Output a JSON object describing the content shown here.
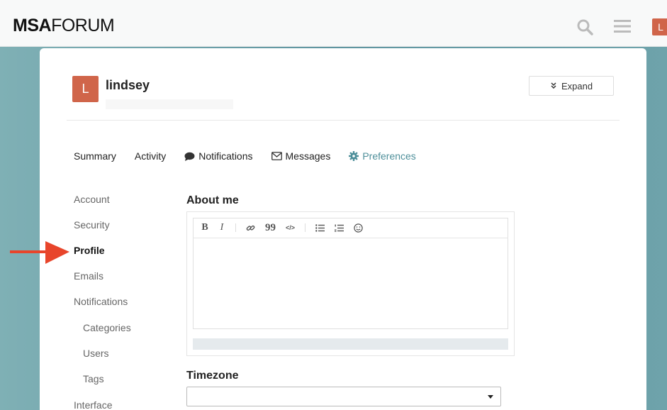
{
  "header": {
    "logo_bold": "MSA",
    "logo_light": "FORUM",
    "search_icon": "search-icon",
    "menu_icon": "hamburger-menu-icon",
    "avatar_letter": "L"
  },
  "user": {
    "avatar_letter": "L",
    "name": "lindsey",
    "expand_label": "Expand"
  },
  "tabs": [
    {
      "label": "Summary",
      "icon": null
    },
    {
      "label": "Activity",
      "icon": null
    },
    {
      "label": "Notifications",
      "icon": "speech-bubble-icon"
    },
    {
      "label": "Messages",
      "icon": "envelope-icon"
    },
    {
      "label": "Preferences",
      "icon": "gear-icon",
      "active": true
    }
  ],
  "sidebar": {
    "items": [
      {
        "label": "Account"
      },
      {
        "label": "Security"
      },
      {
        "label": "Profile",
        "active": true
      },
      {
        "label": "Emails"
      },
      {
        "label": "Notifications"
      },
      {
        "label": "Categories",
        "sub": true
      },
      {
        "label": "Users",
        "sub": true
      },
      {
        "label": "Tags",
        "sub": true
      },
      {
        "label": "Interface"
      }
    ]
  },
  "main": {
    "about_title": "About me",
    "toolbar": {
      "bold": "B",
      "italic": "I",
      "quote": "99",
      "code": "</>"
    },
    "timezone_title": "Timezone",
    "timezone_value": ""
  },
  "colors": {
    "accent": "#4e8f9a",
    "avatar": "#d0654a",
    "arrow": "#e8452b",
    "background": "#6fa0a8"
  }
}
